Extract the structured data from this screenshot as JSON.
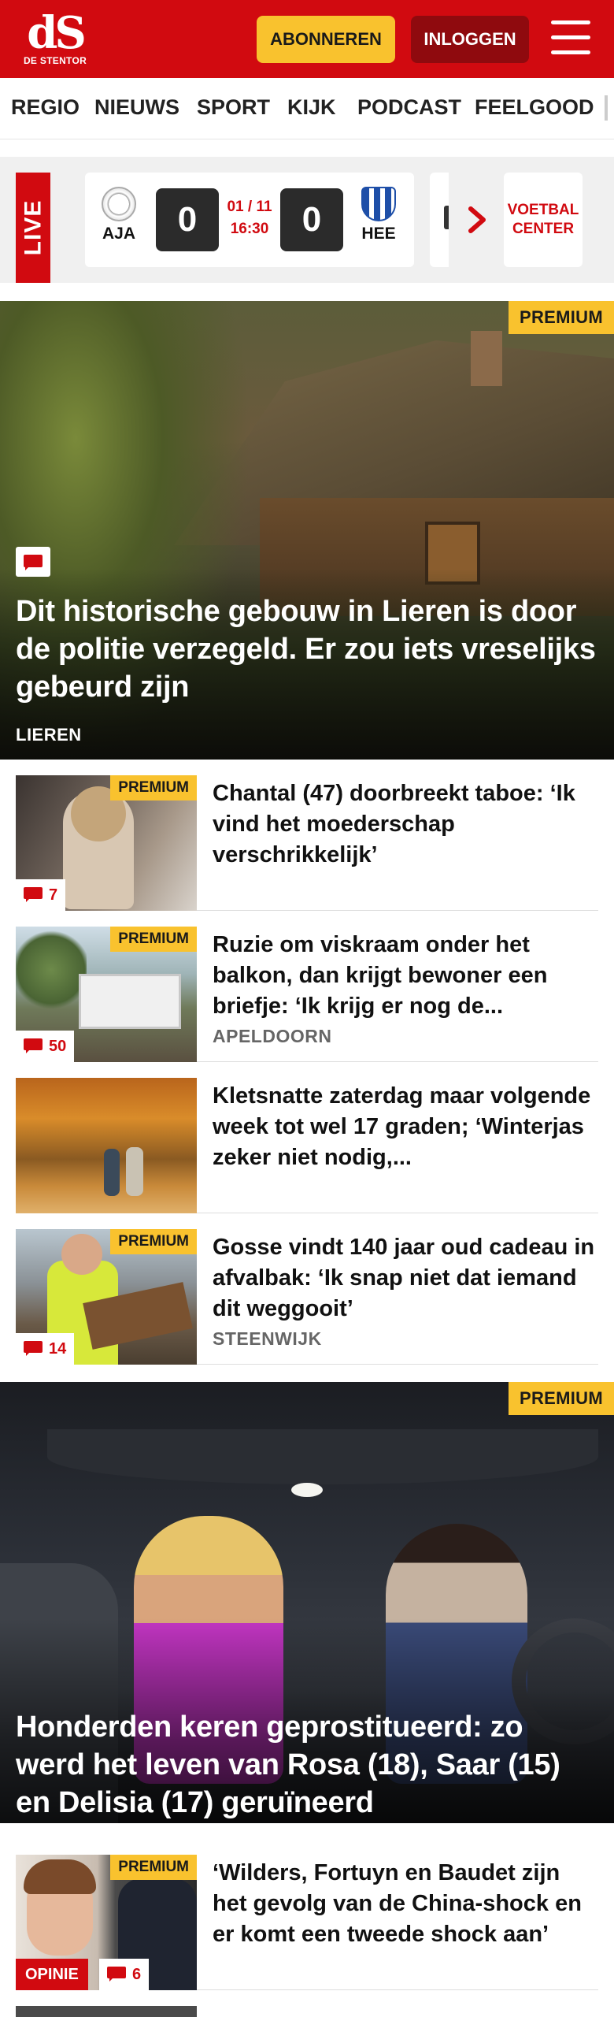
{
  "header": {
    "logo_mark": "dS",
    "logo_sub": "DE STENTOR",
    "subscribe_label": "ABONNEREN",
    "login_label": "INLOGGEN",
    "menu_icon": "hamburger-menu-icon",
    "brand_color": "#d10a10",
    "accent_color": "#f9c22e"
  },
  "nav": {
    "items": [
      "REGIO",
      "NIEUWS",
      "SPORT",
      "KIJK",
      "PODCAST",
      "FEELGOOD"
    ]
  },
  "live": {
    "tag": "LIVE",
    "match": {
      "home": "AJA",
      "away": "HEE",
      "home_score": "0",
      "away_score": "0",
      "date": "01 / 11",
      "time": "16:30"
    },
    "voetbal_center_line1": "VOETBAL",
    "voetbal_center_line2": "CENTER"
  },
  "hero1": {
    "badge": "PREMIUM",
    "title": "Dit historische gebouw in Lieren is door de politie verzegeld. Er zou iets vreselijks gebeurd zijn",
    "kicker": "LIEREN"
  },
  "articles": [
    {
      "premium": "PREMIUM",
      "comments": "7",
      "title": "Chantal (47) doorbreekt taboe: ‘Ik vind het moederschap verschrikkelijk’",
      "kicker": ""
    },
    {
      "premium": "PREMIUM",
      "comments": "50",
      "title": "Ruzie om viskraam onder het balkon, dan krijgt bewoner een briefje: ‘Ik krijg er nog de...",
      "kicker": "APELDOORN"
    },
    {
      "premium": "",
      "comments": "",
      "title": "Kletsnatte zaterdag maar volgende week tot wel 17 graden; ‘Winterjas zeker niet nodig,...",
      "kicker": ""
    },
    {
      "premium": "PREMIUM",
      "comments": "14",
      "title": "Gosse vindt 140 jaar oud cadeau in afvalbak: ‘Ik snap niet dat iemand dit weggooit’",
      "kicker": "STEENWIJK"
    }
  ],
  "hero2": {
    "badge": "PREMIUM",
    "title": "Honderden keren geprostitueerd: zo werd het leven van Rosa (18), Saar (15) en Delisia (17) geruïneerd"
  },
  "article_opinion": {
    "premium": "PREMIUM",
    "label": "OPINIE",
    "comments": "6",
    "title": "‘Wilders, Fortuyn en Baudet zijn het gevolg van de China-shock en er komt een tweede shock aan’"
  }
}
